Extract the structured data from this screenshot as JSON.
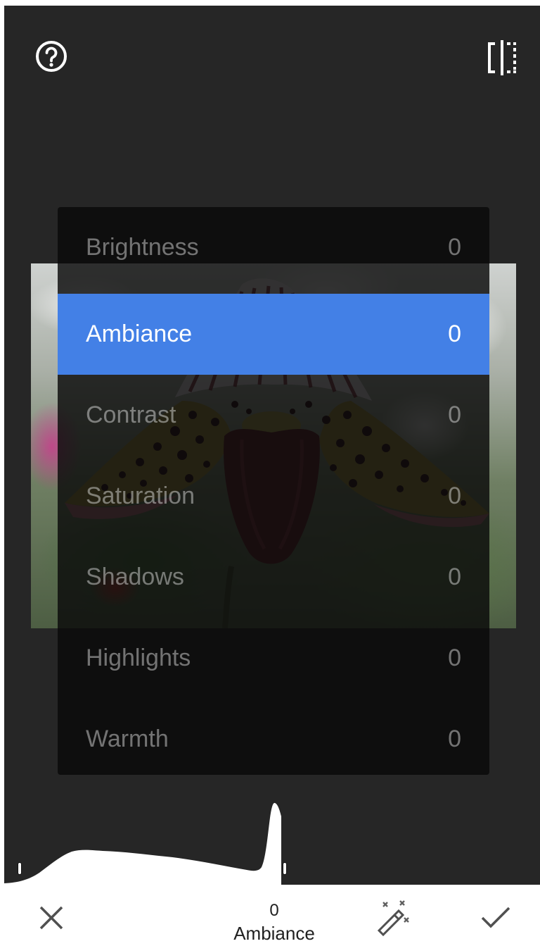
{
  "toolbar": {
    "help_icon": "help-circle-icon",
    "compare_icon": "compare-split-icon"
  },
  "adjustments": {
    "items": [
      {
        "label": "Brightness",
        "value": "0",
        "selected": false
      },
      {
        "label": "Ambiance",
        "value": "0",
        "selected": true
      },
      {
        "label": "Contrast",
        "value": "0",
        "selected": false
      },
      {
        "label": "Saturation",
        "value": "0",
        "selected": false
      },
      {
        "label": "Shadows",
        "value": "0",
        "selected": false
      },
      {
        "label": "Highlights",
        "value": "0",
        "selected": false
      },
      {
        "label": "Warmth",
        "value": "0",
        "selected": false
      }
    ]
  },
  "bottom_bar": {
    "value": "0",
    "parameter": "Ambiance",
    "cancel_icon": "close-icon",
    "auto_icon": "magic-wand-icon",
    "apply_icon": "checkmark-icon"
  },
  "colors": {
    "accent": "#4380e6",
    "editor_background": "#262626",
    "menu_background": "#0a0a0a"
  }
}
